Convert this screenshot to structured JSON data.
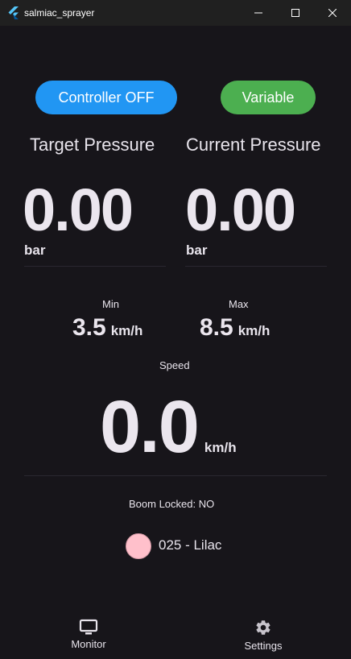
{
  "window": {
    "title": "salmiac_sprayer"
  },
  "controls": {
    "controller_label": "Controller OFF",
    "controller_color": "#2196f3",
    "mode_label": "Variable",
    "mode_color": "#4caf50"
  },
  "pressure": {
    "target_label": "Target Pressure",
    "current_label": "Current Pressure",
    "target_value": "0.00",
    "current_value": "0.00",
    "unit": "bar"
  },
  "speed_range": {
    "min_label": "Min",
    "max_label": "Max",
    "min_value": "3.5",
    "max_value": "8.5",
    "unit": "km/h"
  },
  "speed": {
    "label": "Speed",
    "value": "0.0",
    "unit": "km/h"
  },
  "boom": {
    "status_text": "Boom Locked: NO"
  },
  "nozzle": {
    "label": "025 - Lilac",
    "color": "#ffc0cb"
  },
  "nav": {
    "monitor_label": "Monitor",
    "settings_label": "Settings",
    "monitor_icon": "monitor-icon",
    "settings_icon": "gear-icon"
  }
}
